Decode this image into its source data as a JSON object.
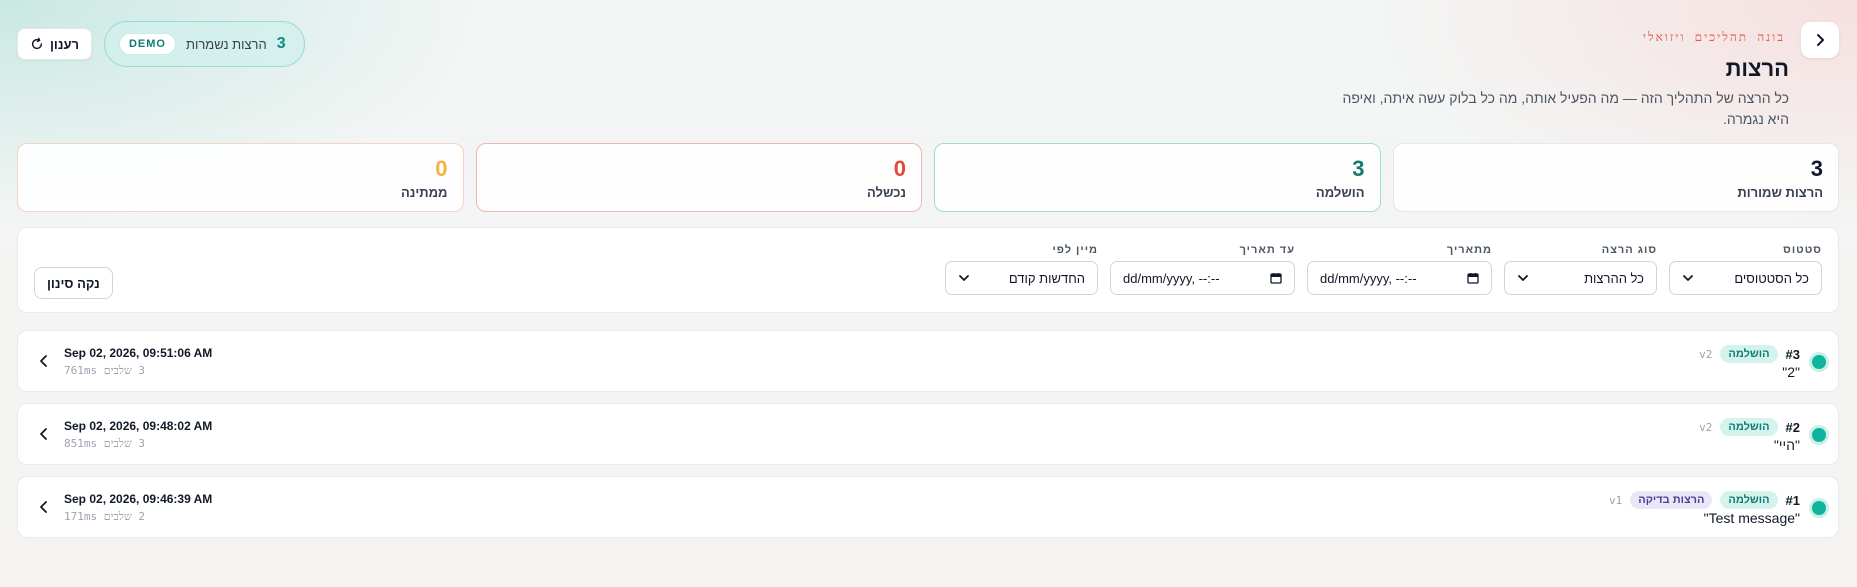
{
  "header": {
    "eyebrow": "בונה תהליכים ויזואלי",
    "title": "הרצות",
    "description": "כל הרצה של התהליך הזה — מה הפעיל אותה, מה כל בלוק עשה איתה, ואיפה היא נגמרה.",
    "saved_count": "3",
    "saved_label": "הרצות נשמרות",
    "demo_badge": "DEMO",
    "refresh_label": "רענון"
  },
  "stats": [
    {
      "value": "3",
      "label": "הרצות שמורות"
    },
    {
      "value": "3",
      "label": "הושלמה"
    },
    {
      "value": "0",
      "label": "נכשלה"
    },
    {
      "value": "0",
      "label": "ממתינה"
    }
  ],
  "filters": {
    "status": {
      "label": "סטטוס",
      "value": "כל הסטטוסים"
    },
    "run_type": {
      "label": "סוג הרצה",
      "value": "כל ההרצות"
    },
    "from_date": {
      "label": "מתאריך",
      "value": "dd/mm/yyyy, --:--"
    },
    "to_date": {
      "label": "עד תאריך",
      "value": "dd/mm/yyyy, --:--"
    },
    "sort": {
      "label": "מיין לפי",
      "value": "החדשות קודם"
    },
    "clear_label": "נקה סינון"
  },
  "runs": [
    {
      "id": "#3",
      "status": "הושלמה",
      "tag": "",
      "version": "v2",
      "message": "\"2\"",
      "date": "Sep 02, 2026, 09:51:06 AM",
      "meta": "3 שלבים 761ms"
    },
    {
      "id": "#2",
      "status": "הושלמה",
      "tag": "",
      "version": "v2",
      "message": "\"היי\"",
      "date": "Sep 02, 2026, 09:48:02 AM",
      "meta": "3 שלבים 851ms"
    },
    {
      "id": "#1",
      "status": "הושלמה",
      "tag": "הרצות בדיקה",
      "version": "v1",
      "message": "\"Test message\"",
      "date": "Sep 02, 2026, 09:46:39 AM",
      "meta": "2 שלבים 171ms"
    }
  ],
  "colors": {
    "accent": "#0f7c74",
    "fail": "#e3493b",
    "pending": "#f0b545",
    "eyebrow": "#e05a47"
  }
}
